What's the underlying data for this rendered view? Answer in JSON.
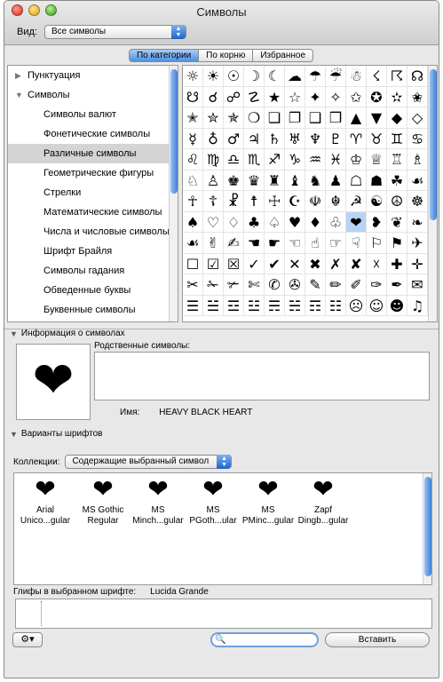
{
  "window": {
    "title": "Символы"
  },
  "view": {
    "label": "Вид:",
    "value": "Все символы"
  },
  "tabs": [
    "По категории",
    "По корню",
    "Избранное"
  ],
  "categories": {
    "top": [
      "Пунктуация",
      "Символы"
    ],
    "sub": [
      "Символы валют",
      "Фонетические символы",
      "Различные символы",
      "Геометрические фигуры",
      "Стрелки",
      "Математические символы",
      "Числа и числовые символы",
      "Шрифт Брайля",
      "Символы гадания",
      "Обведенные буквы",
      "Буквенные символы"
    ]
  },
  "grid": {
    "rows": [
      [
        "☼",
        "☀",
        "☉",
        "☽",
        "☾",
        "☁",
        "☂",
        "☔",
        "☃",
        "☇",
        "☈",
        "☊"
      ],
      [
        "☋",
        "☌",
        "☍",
        "☡",
        "★",
        "☆",
        "✦",
        "✧",
        "✩",
        "✪",
        "✫",
        "✬"
      ],
      [
        "✭",
        "✮",
        "✯",
        "❍",
        "❏",
        "❐",
        "❑",
        "❒",
        "▲",
        "▼",
        "◆",
        "◇"
      ],
      [
        "☿",
        "♁",
        "♂",
        "♃",
        "♄",
        "♅",
        "♆",
        "♇",
        "♈",
        "♉",
        "♊",
        "♋"
      ],
      [
        "♌",
        "♍",
        "♎",
        "♏",
        "♐",
        "♑",
        "♒",
        "♓",
        "♔",
        "♕",
        "♖",
        "♗"
      ],
      [
        "♘",
        "♙",
        "♚",
        "♛",
        "♜",
        "♝",
        "♞",
        "♟",
        "☖",
        "☗",
        "☘",
        "☙"
      ],
      [
        "☥",
        "☦",
        "☧",
        "☨",
        "☩",
        "☪",
        "☫",
        "☬",
        "☭",
        "☯",
        "☮",
        "☸"
      ],
      [
        "♠",
        "♡",
        "♢",
        "♣",
        "♤",
        "♥",
        "♦",
        "♧",
        "❤",
        "❥",
        "❦",
        "❧"
      ],
      [
        "☙",
        "✌",
        "✍",
        "☚",
        "☛",
        "☜",
        "☝",
        "☞",
        "☟",
        "⚐",
        "⚑",
        "✈"
      ],
      [
        "☐",
        "☑",
        "☒",
        "✓",
        "✔",
        "✕",
        "✖",
        "✗",
        "✘",
        "☓",
        "✚",
        "✛"
      ],
      [
        "✂",
        "✁",
        "✃",
        "✄",
        "✆",
        "✇",
        "✎",
        "✏",
        "✐",
        "✑",
        "✒",
        "✉"
      ],
      [
        "☰",
        "☱",
        "☲",
        "☳",
        "☴",
        "☵",
        "☶",
        "☷",
        "☹",
        "☺",
        "☻",
        "♫"
      ]
    ],
    "selected_symbol": "❤"
  },
  "info": {
    "section_label": "Информация о символах",
    "preview_glyph": "❤",
    "related_label": "Родственные символы:",
    "name_label": "Имя:",
    "name_value": "HEAVY BLACK HEART"
  },
  "variants": {
    "section_label": "Варианты шрифтов",
    "collections_label": "Коллекции:",
    "collections_value": "Содержащие выбранный символ",
    "fonts": [
      {
        "glyph": "❤",
        "line1": "Arial",
        "line2": "Unico...gular"
      },
      {
        "glyph": "❤",
        "line1": "MS Gothic",
        "line2": "Regular"
      },
      {
        "glyph": "❤",
        "line1": "MS",
        "line2": "Minch...gular"
      },
      {
        "glyph": "❤",
        "line1": "MS",
        "line2": "PGoth...ular"
      },
      {
        "glyph": "❤",
        "line1": "MS",
        "line2": "PMinc...gular"
      },
      {
        "glyph": "❤",
        "line1": "Zapf",
        "line2": "Dingb...gular"
      }
    ]
  },
  "glyphs": {
    "label": "Глифы в выбранном шрифте:",
    "font": "Lucida Grande"
  },
  "bottom": {
    "insert_label": "Вставить",
    "search_value": "",
    "gear_icon": "⚙▾",
    "search_icon": "🔍"
  }
}
